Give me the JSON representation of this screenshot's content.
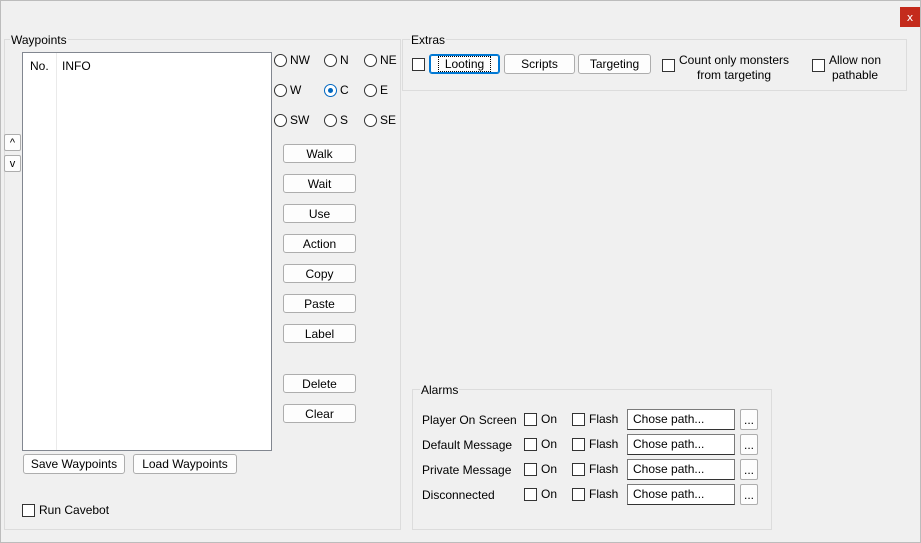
{
  "window": {
    "close_label": "x"
  },
  "waypoints": {
    "group_label": "Waypoints",
    "columns": [
      "No.",
      "INFO"
    ],
    "scroll_up": "^",
    "scroll_down": "v",
    "directions": [
      {
        "label": "NW",
        "checked": false
      },
      {
        "label": "N",
        "checked": false
      },
      {
        "label": "NE",
        "checked": false
      },
      {
        "label": "W",
        "checked": false
      },
      {
        "label": "C",
        "checked": true
      },
      {
        "label": "E",
        "checked": false
      },
      {
        "label": "SW",
        "checked": false
      },
      {
        "label": "S",
        "checked": false
      },
      {
        "label": "SE",
        "checked": false
      }
    ],
    "actions": [
      "Walk",
      "Wait",
      "Use",
      "Action",
      "Copy",
      "Paste",
      "Label",
      "Delete",
      "Clear"
    ],
    "save_label": "Save Waypoints",
    "load_label": "Load Waypoints",
    "run_cavebot_label": "Run Cavebot"
  },
  "extras": {
    "group_label": "Extras",
    "looting_label": "Looting",
    "scripts_label": "Scripts",
    "targeting_label": "Targeting",
    "count_only_label_1": "Count only monsters",
    "count_only_label_2": "from targeting",
    "allow_non_label_1": "Allow non",
    "allow_non_label_2": "pathable"
  },
  "alarms": {
    "group_label": "Alarms",
    "on_label": "On",
    "flash_label": "Flash",
    "path_placeholder": "Chose path...",
    "browse_label": "...",
    "rows": [
      {
        "label": "Player On Screen",
        "path": "Chose path..."
      },
      {
        "label": "Default Message",
        "path": "Chose path..."
      },
      {
        "label": "Private Message",
        "path": "Chose path..."
      },
      {
        "label": "Disconnected",
        "path": "Chose path..."
      }
    ]
  }
}
